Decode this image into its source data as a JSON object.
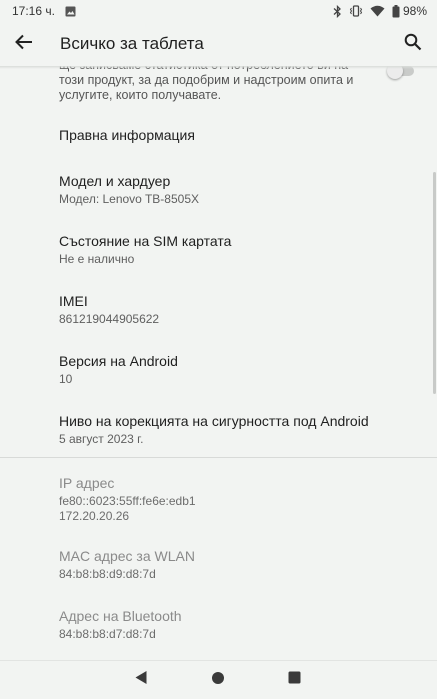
{
  "status_bar": {
    "time": "17:16 ч.",
    "battery": "98%"
  },
  "app_bar": {
    "title": "Всичко за таблета"
  },
  "partial_item": {
    "text": "ще записваме статистика от потреблението ви на този продукт, за да подобрим и надстроим опита и услугите, които получавате."
  },
  "items": [
    {
      "title": "Правна информация",
      "subtitle": ""
    },
    {
      "title": "Модел и хардуер",
      "subtitle": "Модел: Lenovo TB-8505X"
    },
    {
      "title": "Състояние на SIM картата",
      "subtitle": "Не е налично"
    },
    {
      "title": "IMEI",
      "subtitle": "861219044905622"
    },
    {
      "title": "Версия на Android",
      "subtitle": "10"
    },
    {
      "title": "Ниво на корекцията на сигурността под Android",
      "subtitle": "5 август 2023 г."
    }
  ],
  "network_items": [
    {
      "title": "IP адрес",
      "subtitle_line1": "fe80::6023:55ff:fe6e:edb1",
      "subtitle_line2": "172.20.20.26"
    },
    {
      "title": "MAC адрес за WLAN",
      "subtitle": "84:b8:b8:d9:d8:7d"
    },
    {
      "title": "Адрес на Bluetooth",
      "subtitle": "84:b8:b8:d7:d8:7d"
    }
  ],
  "icons": {
    "back": "arrow-back-icon",
    "search": "search-icon",
    "image_notification": "image-icon",
    "bluetooth": "bluetooth-icon",
    "vibrate": "vibrate-icon",
    "wifi": "wifi-icon",
    "battery": "battery-icon"
  }
}
